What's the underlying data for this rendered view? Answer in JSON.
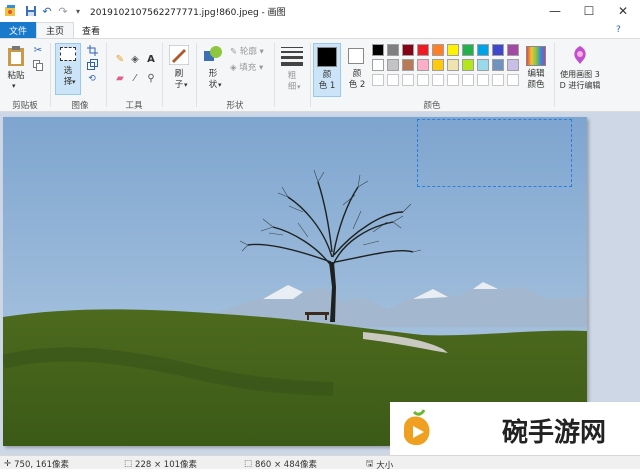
{
  "window": {
    "title": "20191021075622777​71.jpg!860.jpeg - 画图",
    "minimize": "—",
    "maximize": "☐",
    "close": "✕"
  },
  "tabs": {
    "file": "文件",
    "home": "主页",
    "view": "查看"
  },
  "ribbon": {
    "clipboard": {
      "paste": "粘贴",
      "group": "剪贴板"
    },
    "image": {
      "select": "选\n择",
      "group": "图像"
    },
    "tools": {
      "group": "工具"
    },
    "brushes": {
      "label": "刷\n子"
    },
    "shapes": {
      "label": "形\n状",
      "outline": "轮廓",
      "fill": "填充",
      "group": "形状"
    },
    "size": {
      "label": "粗\n细"
    },
    "colors": {
      "color1": "颜\n色 1",
      "color2": "颜\n色 2",
      "edit": "编辑\n颜色",
      "group": "颜色",
      "palette_row1": [
        "#000000",
        "#7f7f7f",
        "#880015",
        "#ed1c24",
        "#ff7f27",
        "#fff200",
        "#22b14c",
        "#00a2e8",
        "#3f48cc",
        "#a349a4"
      ],
      "palette_row2": [
        "#ffffff",
        "#c3c3c3",
        "#b97a57",
        "#ffaec9",
        "#ffc90e",
        "#efe4b0",
        "#b5e61d",
        "#99d9ea",
        "#7092be",
        "#c8bfe7"
      ],
      "palette_row3": [
        "#ffffff",
        "#ffffff",
        "#ffffff",
        "#ffffff",
        "#ffffff",
        "#ffffff",
        "#ffffff",
        "#ffffff",
        "#ffffff",
        "#ffffff"
      ]
    },
    "paint3d": {
      "label": "使用画图 3\nD 进行编辑"
    }
  },
  "watermark": {
    "text": "碗手游网"
  },
  "status": {
    "cursor": "750, 161像素",
    "selection": "228 × 101像素",
    "image_size": "860 × 484像素",
    "disk": "大小"
  }
}
